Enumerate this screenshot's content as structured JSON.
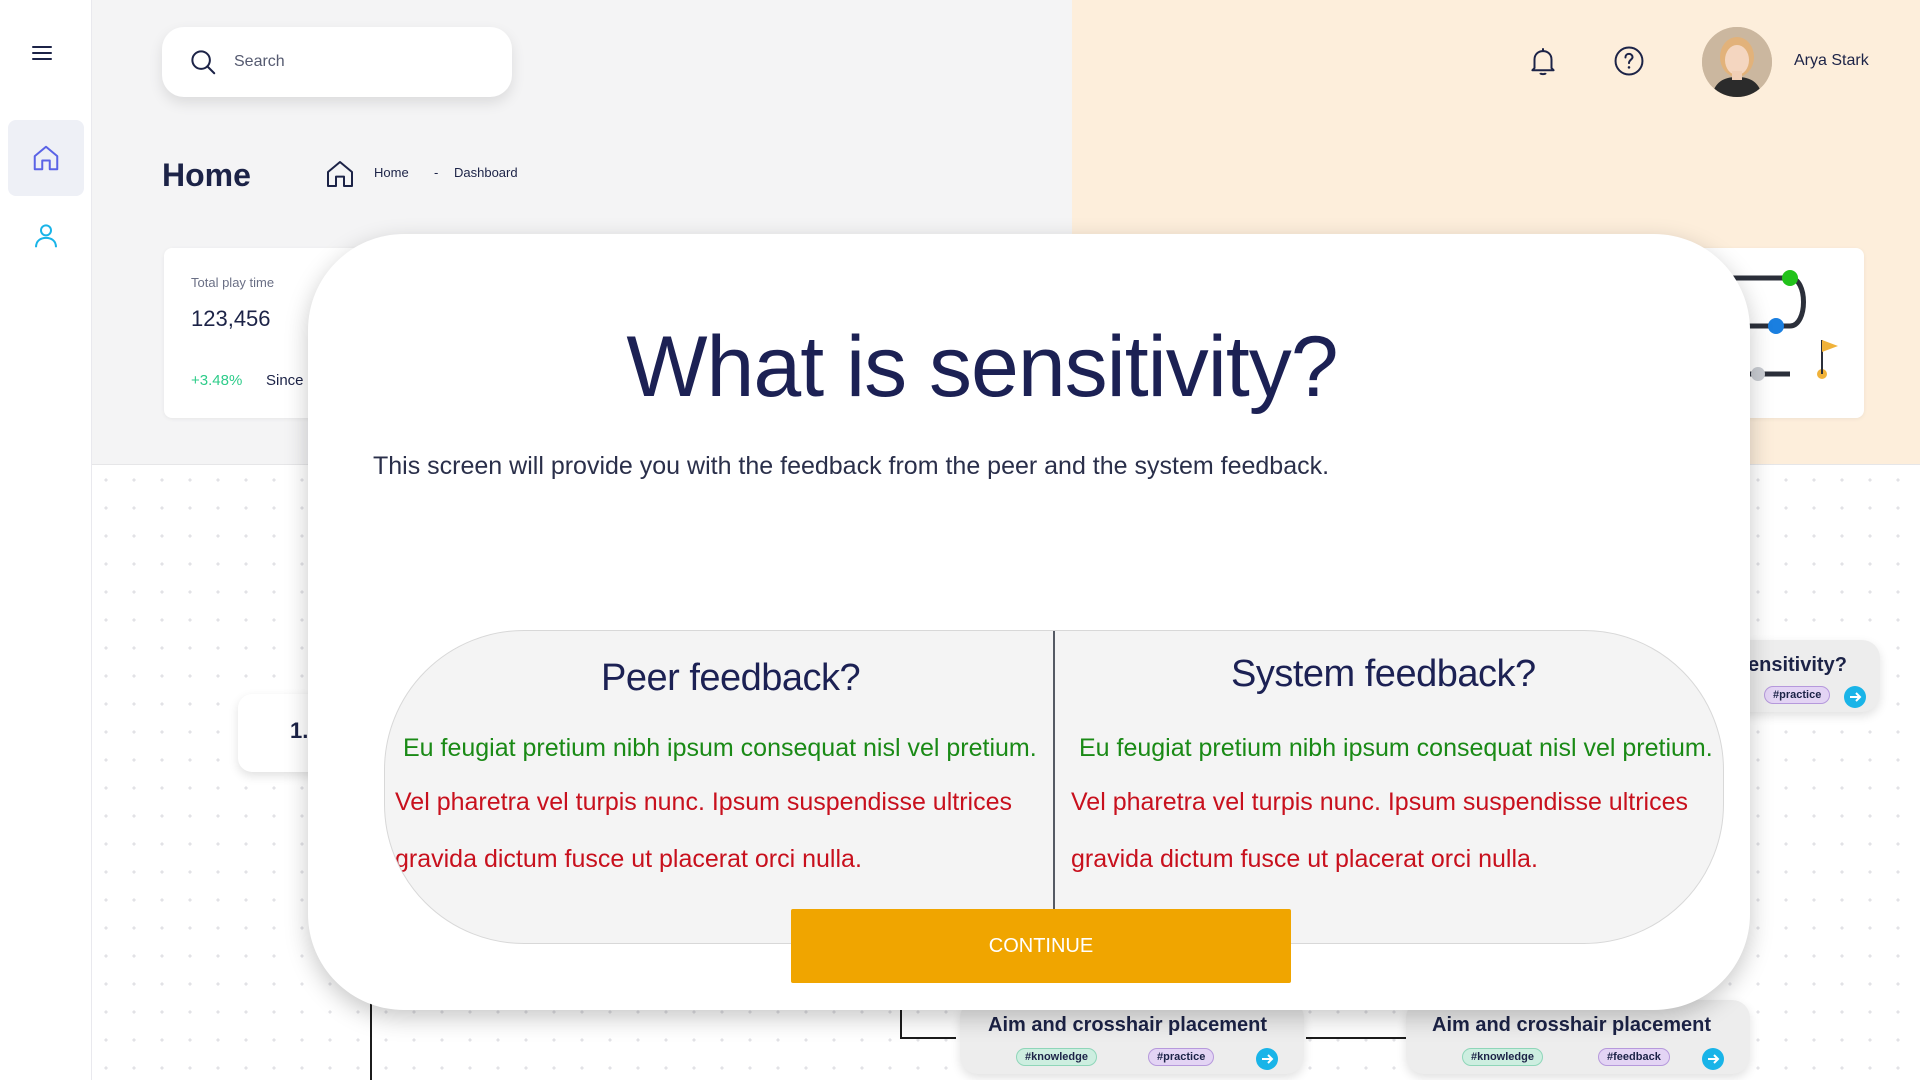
{
  "sidebar": {
    "menu_icon": "hamburger-menu-icon",
    "items": [
      {
        "name": "home",
        "icon": "home-icon",
        "active": true
      },
      {
        "name": "profile",
        "icon": "user-icon",
        "active": false
      }
    ]
  },
  "header": {
    "search": {
      "placeholder": "Search",
      "value": ""
    },
    "notification_icon": "bell-icon",
    "help_icon": "help-circle-icon",
    "user": {
      "name": "Arya Stark"
    }
  },
  "page": {
    "title": "Home",
    "breadcrumb": [
      "Home",
      "-",
      "Dashboard"
    ]
  },
  "stat_card": {
    "label": "Total play time",
    "value": "123,456",
    "change": "+3.48%",
    "since": "Since"
  },
  "background_cards": [
    {
      "title": "ensitivity?",
      "tags": [
        "#practice"
      ]
    },
    {
      "title": "Aim and crosshair placement",
      "tags": [
        "#knowledge",
        "#practice"
      ]
    },
    {
      "title": "Aim and crosshair placement",
      "tags": [
        "#knowledge",
        "#feedback"
      ]
    }
  ],
  "step_card": {
    "number": "1."
  },
  "modal": {
    "title": "What is sensitivity?",
    "subtitle": "This screen will provide you with the feedback from the peer and the system feedback.",
    "peer": {
      "heading": "Peer feedback?",
      "positive": "Eu feugiat pretium nibh ipsum consequat nisl vel pretium.",
      "negative_1": "Vel pharetra vel turpis nunc. Ipsum suspendisse ultrices",
      "negative_2": "gravida dictum fusce ut placerat orci nulla."
    },
    "system": {
      "heading": "System feedback?",
      "positive": "Eu feugiat pretium nibh ipsum consequat nisl vel pretium.",
      "negative_1": "Vel pharetra vel turpis nunc. Ipsum suspendisse ultrices",
      "negative_2": "gravida dictum fusce ut placerat orci nulla."
    },
    "continue_label": "CONTINUE"
  },
  "colors": {
    "accent": "#f0a500",
    "positive": "#1a8a16",
    "negative": "#c8101d",
    "navy": "#1c2154",
    "peach": "#fdeedb"
  }
}
